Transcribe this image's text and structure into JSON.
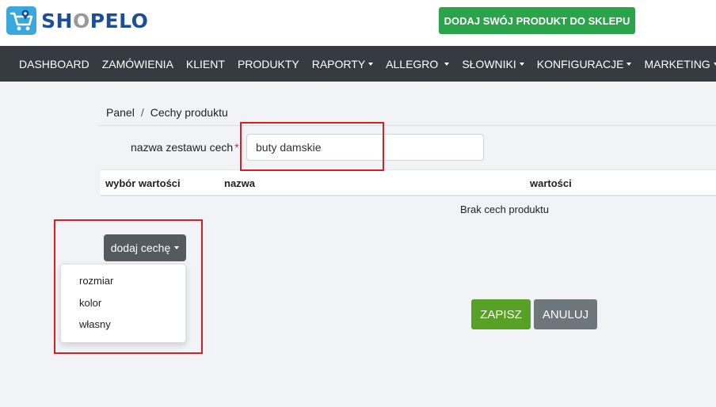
{
  "header": {
    "logo_text_1": "SH",
    "logo_text_2": "O",
    "logo_text_3": "PELO",
    "icon": "shopping-cart-logo-icon",
    "cta_label": "DODAJ SWÓJ PRODUKT DO SKLEPU"
  },
  "nav": {
    "items": [
      {
        "label": "DASHBOARD",
        "dropdown": false
      },
      {
        "label": "ZAMÓWIENIA",
        "dropdown": false
      },
      {
        "label": "KLIENT",
        "dropdown": false
      },
      {
        "label": "PRODUKTY",
        "dropdown": false
      },
      {
        "label": "RAPORTY",
        "dropdown": true
      },
      {
        "label": "ALLEGRO",
        "dropdown": true
      },
      {
        "label": "SŁOWNIKI",
        "dropdown": true
      },
      {
        "label": "KONFIGURACJE",
        "dropdown": true
      },
      {
        "label": "MARKETING",
        "dropdown": true
      }
    ]
  },
  "breadcrumb": {
    "root": "Panel",
    "separator": "/",
    "current": "Cechy produktu"
  },
  "form": {
    "set_name_label": "nazwa zestawu cech",
    "required_mark": "*",
    "set_name_value": "buty damskie"
  },
  "table": {
    "columns": [
      "wybór wartości",
      "nazwa",
      "wartości"
    ],
    "empty_message": "Brak cech produktu"
  },
  "add_feature": {
    "button_label": "dodaj cechę",
    "options": [
      "rozmiar",
      "kolor",
      "własny"
    ]
  },
  "actions": {
    "save_label": "ZAPISZ",
    "cancel_label": "ANULUJ"
  },
  "colors": {
    "navbar": "#363b41",
    "cta": "#2aa34a",
    "save": "#57a127",
    "cancel": "#6d757d",
    "highlight": "#d62020",
    "logo_blue": "#1d4f96"
  }
}
